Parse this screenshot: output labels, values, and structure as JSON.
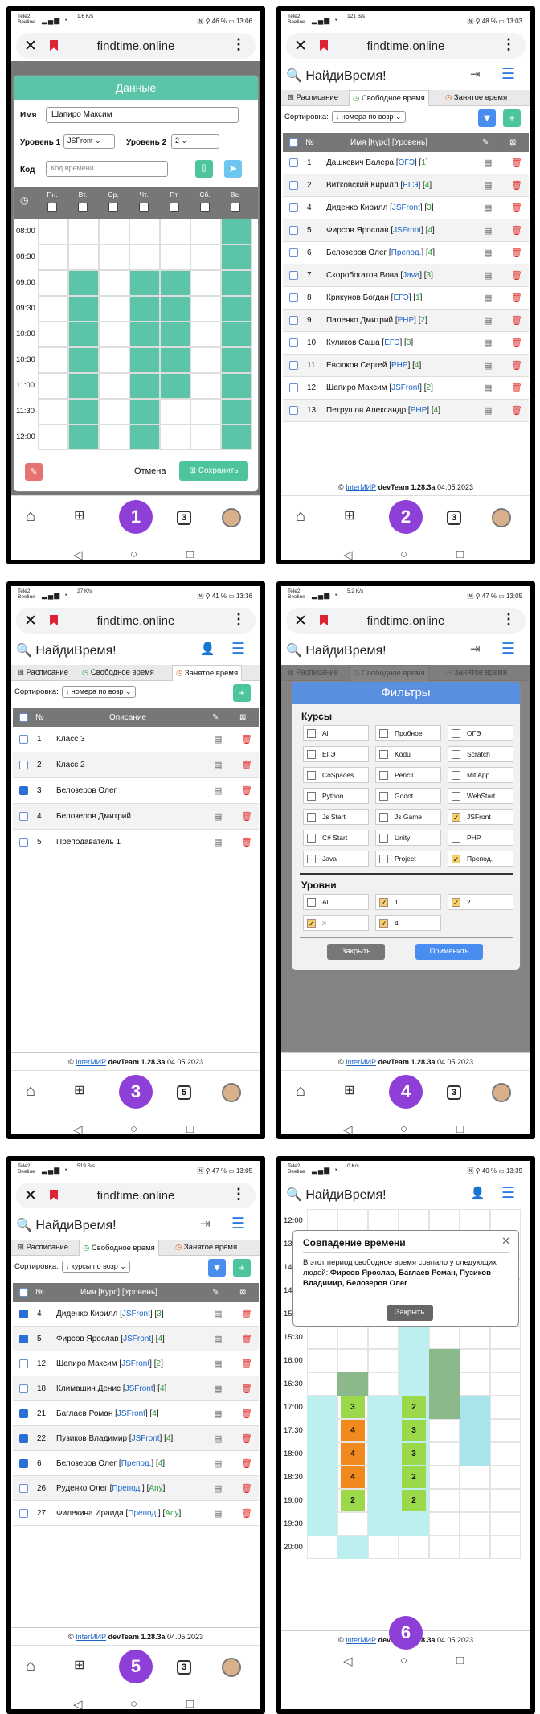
{
  "status": {
    "carrier1": "Tele2",
    "carrier2": "Beeline",
    "speed": [
      "1,6 K/s",
      "121 B/s",
      "27 K/s",
      "5,2 K/s",
      "519 B/s",
      "0 K/s"
    ],
    "battery": [
      "46 %",
      "48 %",
      "41 %",
      "47 %",
      "47 %",
      "40 %"
    ],
    "time": [
      "13:06",
      "13:03",
      "13:36",
      "13:05",
      "13:05",
      "13:39"
    ]
  },
  "browser": {
    "url": "findtime.online",
    "tabs_count": [
      "3",
      "3",
      "5",
      "3",
      "3"
    ]
  },
  "app": {
    "name": "НайдиВремя!",
    "tab_schedule": "Расписание",
    "tab_free": "Свободное время",
    "tab_busy": "Занятое время",
    "sort_label": "Сортировка:",
    "sort_number": "↓ номера по возр",
    "sort_course": "↓ курсы по возр",
    "col_num": "№",
    "col_name": "Имя [Курс] [Уровень]",
    "col_desc": "Описание"
  },
  "footer": {
    "link": "InterМИР",
    "team": "devTeam",
    "version": "1.28.3a",
    "date": "04.05.2023"
  },
  "badges": [
    "1",
    "2",
    "3",
    "4",
    "5",
    "6"
  ],
  "s1": {
    "title": "Данные",
    "name_label": "Имя",
    "name_value": "Шапиро Максим",
    "level1_label": "Уровень 1",
    "level1_value": "JSFront",
    "level2_label": "Уровень 2",
    "level2_value": "2",
    "code_label": "Код",
    "code_placeholder": "Код времени",
    "days": [
      "Пн.",
      "Вт.",
      "Ср.",
      "Чт.",
      "Пт.",
      "Сб.",
      "Вс."
    ],
    "times": [
      "08:00",
      "08:30",
      "09:00",
      "09:30",
      "10:00",
      "10:30",
      "11:00",
      "11:30",
      "12:00"
    ],
    "cancel": "Отмена",
    "save": "Сохранить"
  },
  "s2": {
    "rows": [
      [
        "1",
        "Дашкевич Валера",
        "ОГЭ",
        "1"
      ],
      [
        "2",
        "Витковский Кирилл",
        "ЕГЭ",
        "4"
      ],
      [
        "4",
        "Диденко Кирилл",
        "JSFront",
        "3"
      ],
      [
        "5",
        "Фирсов Ярослав",
        "JSFront",
        "4"
      ],
      [
        "6",
        "Белозеров Олег",
        "Препод.",
        "4"
      ],
      [
        "7",
        "Скоробогатов Вова",
        "Java",
        "3"
      ],
      [
        "8",
        "Крикунов Богдан",
        "ЕГЭ",
        "1"
      ],
      [
        "9",
        "Паленко Дмитрий",
        "PHP",
        "2"
      ],
      [
        "10",
        "Куликов Саша",
        "ЕГЭ",
        "3"
      ],
      [
        "11",
        "Евсюков Сергей",
        "PHP",
        "4"
      ],
      [
        "12",
        "Шапиро Максим",
        "JSFront",
        "2"
      ],
      [
        "13",
        "Петрушов Александр",
        "PHP",
        "4"
      ]
    ]
  },
  "s3": {
    "rows": [
      [
        "1",
        "Класс 3"
      ],
      [
        "2",
        "Класс 2"
      ],
      [
        "3",
        "Белозеров Олег"
      ],
      [
        "4",
        "Белозеров Дмитрий"
      ],
      [
        "5",
        "Преподаватель 1"
      ]
    ]
  },
  "s4": {
    "title": "Фильтры",
    "courses_label": "Курсы",
    "levels_label": "Уровни",
    "courses": [
      "All",
      "Пробное",
      "ОГЭ",
      "ЕГЭ",
      "Kodu",
      "Scratch",
      "CoSpaces",
      "Pencil",
      "Mit App",
      "Python",
      "Godot",
      "WebStart",
      "Js Start",
      "Js Game",
      "JSFront",
      "C# Start",
      "Unity",
      "PHP",
      "Java",
      "Project",
      "Препод."
    ],
    "courses_checked": [
      14,
      20
    ],
    "levels": [
      "All",
      "1",
      "2",
      "3",
      "4"
    ],
    "levels_checked": [
      1,
      2,
      3,
      4
    ],
    "close": "Закрыть",
    "apply": "Применить"
  },
  "s5": {
    "rows": [
      [
        "4",
        "Диденко Кирилл",
        "JSFront",
        "3"
      ],
      [
        "5",
        "Фирсов Ярослав",
        "JSFront",
        "4"
      ],
      [
        "12",
        "Шапиро Максим",
        "JSFront",
        "2"
      ],
      [
        "18",
        "Климашин Денис",
        "JSFront",
        "4"
      ],
      [
        "21",
        "Баглаев Роман",
        "JSFront",
        "4"
      ],
      [
        "22",
        "Пузиков Владимир",
        "JSFront",
        "4"
      ],
      [
        "6",
        "Белозеров Олег",
        "Препод.",
        "4"
      ],
      [
        "26",
        "Руденко Олег",
        "Препод.",
        "Any"
      ],
      [
        "27",
        "Филекина Ираида",
        "Препод.",
        "Any"
      ]
    ],
    "checked": [
      0,
      1,
      4,
      5,
      6
    ]
  },
  "s6": {
    "times": [
      "12:00",
      "13:00",
      "14:00",
      "14:30",
      "15:00",
      "15:30",
      "16:00",
      "16:30",
      "17:00",
      "17:30",
      "18:00",
      "18:30",
      "19:00",
      "19:30",
      "20:00"
    ],
    "popup_title": "Совпадение времени",
    "popup_text": "В этот период свободное время совпало у следующих людей:",
    "popup_names": "Фирсов Ярослав, Баглаев Роман, Пузиков Владимир, Белозеров Олег",
    "popup_close": "Закрыть",
    "col1": [
      "3",
      "4",
      "4",
      "4",
      "2"
    ],
    "col3": [
      "2",
      "3",
      "3",
      "2",
      "2"
    ]
  }
}
